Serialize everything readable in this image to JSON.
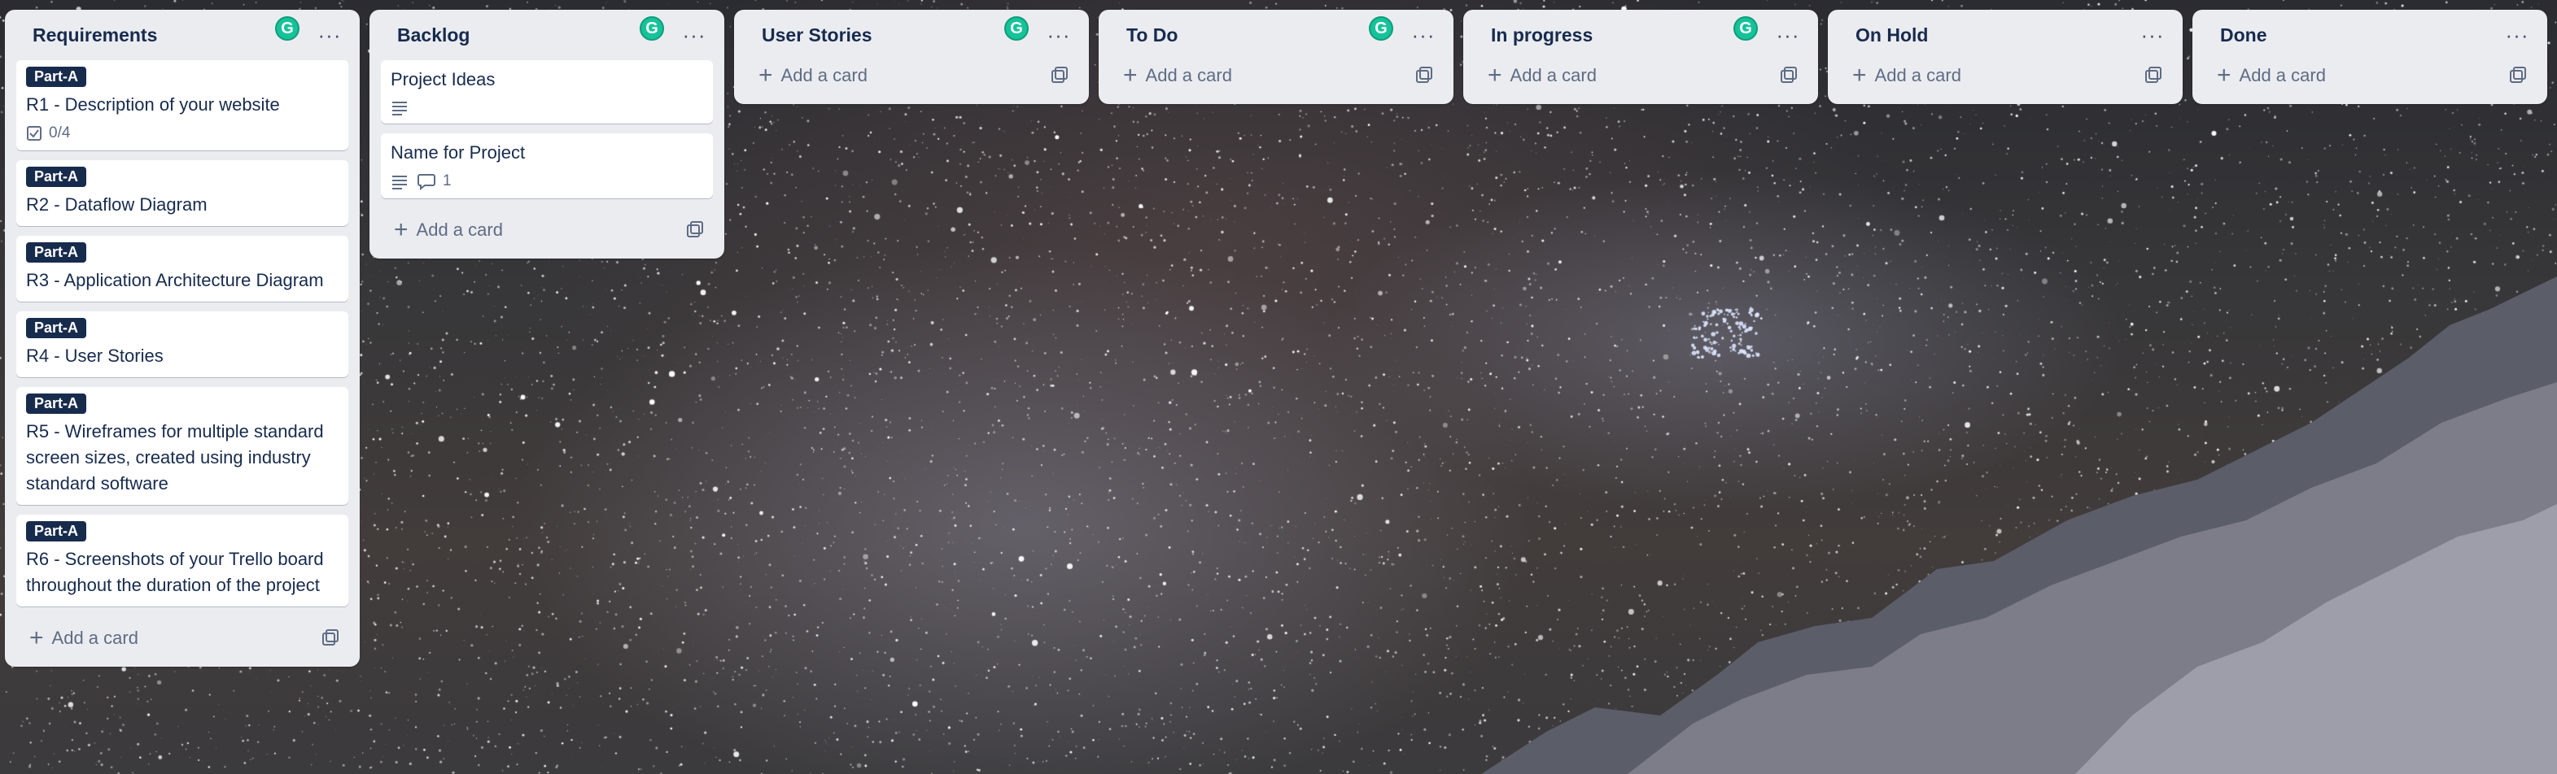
{
  "accent": {
    "grammarly": "#15c39a",
    "label_bg": "#172b4d"
  },
  "lists": [
    {
      "title": "Requirements",
      "add_card": "Add a card",
      "cards": [
        {
          "label": "Part-A",
          "title": "R1 - Description of your website",
          "checklist": "0/4"
        },
        {
          "label": "Part-A",
          "title": "R2 - Dataflow Diagram"
        },
        {
          "label": "Part-A",
          "title": "R3 - Application Architecture Diagram"
        },
        {
          "label": "Part-A",
          "title": "R4 - User Stories"
        },
        {
          "label": "Part-A",
          "title": "R5 - Wireframes for multiple standard screen sizes, created using industry standard software"
        },
        {
          "label": "Part-A",
          "title": "R6 - Screenshots of your Trello board throughout the duration of the project"
        }
      ]
    },
    {
      "title": "Backlog",
      "add_card": "Add a card",
      "cards": [
        {
          "title": "Project Ideas",
          "description_icon": "description-icon"
        },
        {
          "title": "Name for Project",
          "description_icon": "description-icon",
          "comments": "1"
        }
      ]
    },
    {
      "title": "User Stories",
      "add_card": "Add a card"
    },
    {
      "title": "To Do",
      "add_card": "Add a card"
    },
    {
      "title": "In progress",
      "add_card": "Add a card"
    },
    {
      "title": "On Hold",
      "add_card": "Add a card"
    },
    {
      "title": "Done",
      "add_card": "Add a card"
    }
  ]
}
